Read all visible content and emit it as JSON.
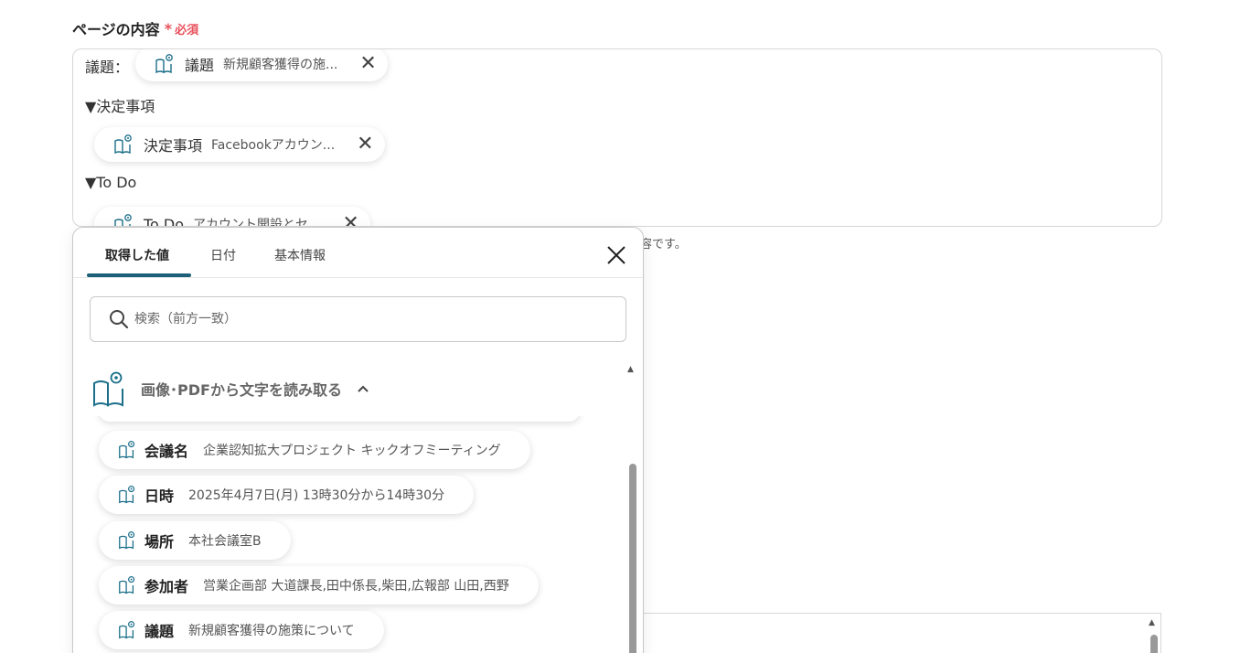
{
  "field": {
    "label": "ページの内容",
    "required_star": "*",
    "required_text": "必須"
  },
  "editor": {
    "line1_prefix": "議題：",
    "chip1": {
      "name": "議題",
      "value": "新規顧客獲得の施..."
    },
    "line2": "▼決定事項",
    "chip2": {
      "name": "決定事項",
      "value": "Facebookアカウン..."
    },
    "line3": "▼To Do",
    "chip3": {
      "name": "To Do",
      "value": "アカウント開設とセ..."
    }
  },
  "help_text": "容です。",
  "panel": {
    "tabs": [
      {
        "label": "取得した値"
      },
      {
        "label": "日付"
      },
      {
        "label": "基本情報"
      }
    ],
    "close_symbol": "✕",
    "search": {
      "placeholder": "検索（前方一致）"
    },
    "group_title": "画像･PDFから文字を読み取る",
    "items": [
      {
        "name": "会議名",
        "value": "企業認知拡大プロジェクト キックオフミーティング"
      },
      {
        "name": "日時",
        "value": "2025年4月7日(月) 13時30分から14時30分"
      },
      {
        "name": "場所",
        "value": "本社会議室B"
      },
      {
        "name": "参加者",
        "value": "営業企画部 大道課長,田中係長,柴田,広報部 山田,西野"
      },
      {
        "name": "議題",
        "value": "新規顧客獲得の施策について"
      }
    ]
  },
  "colors": {
    "accent": "#1b5f78",
    "required": "#e8505b",
    "icon": "#1b6f8a"
  }
}
